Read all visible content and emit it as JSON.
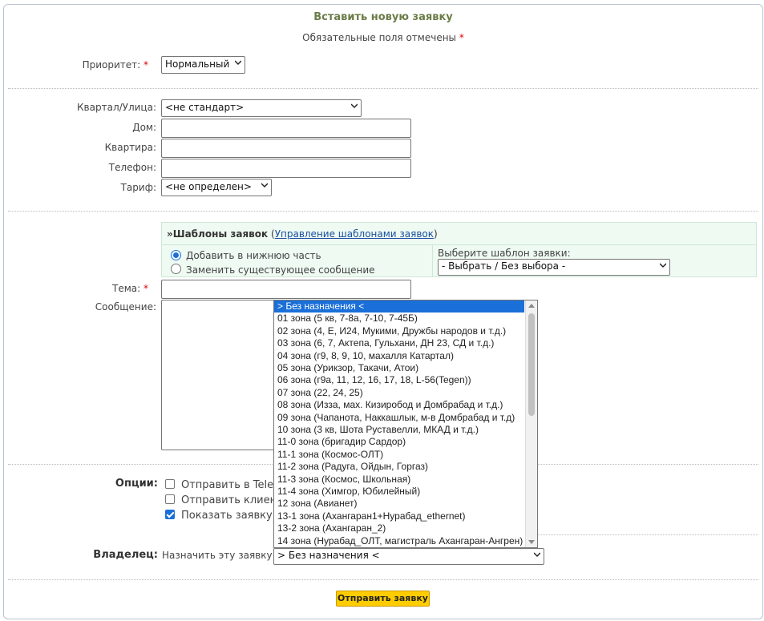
{
  "form": {
    "title": "Вставить новую заявку",
    "required_note": "Обязательные поля отмечены",
    "required_mark": "*"
  },
  "priority": {
    "label": "Приоритет:",
    "value": "Нормальный"
  },
  "address": {
    "street_label": "Квартал/Улица:",
    "street_value": "<не стандарт>",
    "house_label": "Дом:",
    "house_value": "",
    "apartment_label": "Квартира:",
    "apartment_value": "",
    "phone_label": "Телефон:",
    "phone_value": "",
    "tariff_label": "Тариф:",
    "tariff_value": "<не определен>"
  },
  "templates": {
    "heading": "»Шаблоны заявок",
    "open_paren": "(",
    "manage_link": "Управление шаблонами заявок",
    "close_paren": ")",
    "radio_append": "Добавить в нижнюю часть",
    "radio_replace": "Заменить существующее сообщение",
    "radio_append_checked": true,
    "choose_label": "Выберите шаблон заявки:",
    "choose_value": "- Выбрать / Без выбора -"
  },
  "subject": {
    "label": "Тема:",
    "value": ""
  },
  "message": {
    "label": "Сообщение:"
  },
  "options": {
    "label": "Опции:",
    "items": [
      {
        "text": "Отправить в Telegram",
        "checked": false
      },
      {
        "text": "Отправить клиенту",
        "checked": false
      },
      {
        "text": "Показать заявку п",
        "checked": true
      }
    ]
  },
  "owner": {
    "label": "Владелец:",
    "assign_text": "Назначить эту заявку",
    "value": "> Без назначения <"
  },
  "owner_list": {
    "selected_index": 0,
    "items": [
      "> Без назначения <",
      "01 зона (5 кв, 7-8а, 7-10, 7-45Б)",
      "02 зона (4, Е, И24, Мукими, Дружбы народов и т.д.)",
      "03 зона (6, 7, Актепа, Гульхани, ДН 23, СД и т.д.)",
      "04 зона (г9, 8, 9, 10, махалля Катартал)",
      "05 зона (Урикзор, Такачи, Атои)",
      "06 зона (г9а, 11, 12, 16, 17, 18, L-56(Tegen))",
      "07 зона (22, 24, 25)",
      "08 зона (Изза, мах. Кизиробод и Домбрабад и т.д.)",
      "09 зона (Чапанота, Наккашлык, м-в Домбрабад и т.д)",
      "10 зона (3 кв, Шота Руставелли, МКАД и т.д.)",
      "11-0 зона (бригадир Сардор)",
      "11-1 зона (Космос-ОЛТ)",
      "11-2 зона (Радуга, Ойдын, Горгаз)",
      "11-3 зона (Космос, Школьная)",
      "11-4 зона (Химгор, Юбилейный)",
      "12 зона (Авианет)",
      "13-1 зона (Ахангаран1+Нурабад_ethernet)",
      "13-2 зона (Ахангаран_2)",
      "14 зона (Нурабад_ОЛТ, магистраль Ахангаран-Ангрен)"
    ]
  },
  "submit": {
    "label": "Отправить заявку"
  },
  "colors": {
    "accent": "#1a6fd8",
    "submit_bg": "#ffcc00",
    "title": "#6b7c47",
    "required": "#dd0000"
  }
}
